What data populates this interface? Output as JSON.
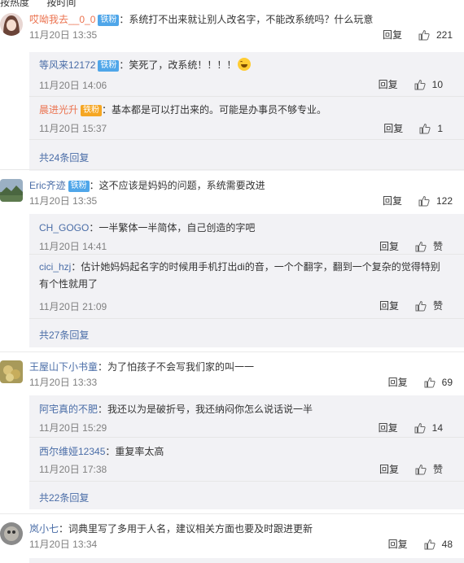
{
  "tabs": [
    "按热度",
    "按时间"
  ],
  "threads": [
    {
      "user": "哎呦我去__0_0",
      "badge": "铁粉",
      "text": "：系统打不出来就让别人改名字，不能改系统吗？什么玩意",
      "time": "11月20日 13:35",
      "reply_label": "回复",
      "likes": "221",
      "replies": [
        {
          "user": "等风来12172",
          "badge": "铁粉",
          "text": "：笑死了，改系统！！！！",
          "time": "11月20日 14:06",
          "reply_label": "回复",
          "likes": "10"
        },
        {
          "user": "晨进光升",
          "badge": "铁粉",
          "text": "：基本都是可以打出来的。可能是办事员不够专业。",
          "time": "11月20日 15:37",
          "reply_label": "回复",
          "likes": "1"
        }
      ],
      "more": "共24条回复"
    },
    {
      "user": "Eric齐迹",
      "badge": "铁粉",
      "text": "：这不应该是妈妈的问题，系统需要改进",
      "time": "11月20日 13:35",
      "reply_label": "回复",
      "likes": "122",
      "replies": [
        {
          "user": "CH_GOGO",
          "text": "：一半繁体一半简体，自己创造的字吧",
          "time": "11月20日 14:41",
          "reply_label": "回复",
          "likes": "赞"
        },
        {
          "user": "cici_hzj",
          "text": "：估计她妈妈起名字的时候用手机打出di的音，一个个翻字，翻到一个复杂的觉得特别有个性就用了",
          "time": "11月20日 21:09",
          "reply_label": "回复",
          "likes": "赞"
        }
      ],
      "more": "共27条回复"
    },
    {
      "user": "王屋山下小书童",
      "text": "：为了怕孩子不会写我们家的叫一一",
      "time": "11月20日 13:33",
      "reply_label": "回复",
      "likes": "69",
      "replies": [
        {
          "user": "阿宅真的不肥",
          "text": "：我还以为是破折号，我还纳闷你怎么说话说一半",
          "time": "11月20日 15:29",
          "reply_label": "回复",
          "likes": "14"
        },
        {
          "user": "西尔维娅12345",
          "text": "：重复率太高",
          "time": "11月20日 17:38",
          "reply_label": "回复",
          "likes": "赞"
        }
      ],
      "more": "共22条回复"
    },
    {
      "user": "岚小七",
      "text": "：词典里写了多用于人名，建议相关方面也要及时跟进更新",
      "time": "11月20日 13:34",
      "reply_label": "回复",
      "likes": "48"
    }
  ]
}
